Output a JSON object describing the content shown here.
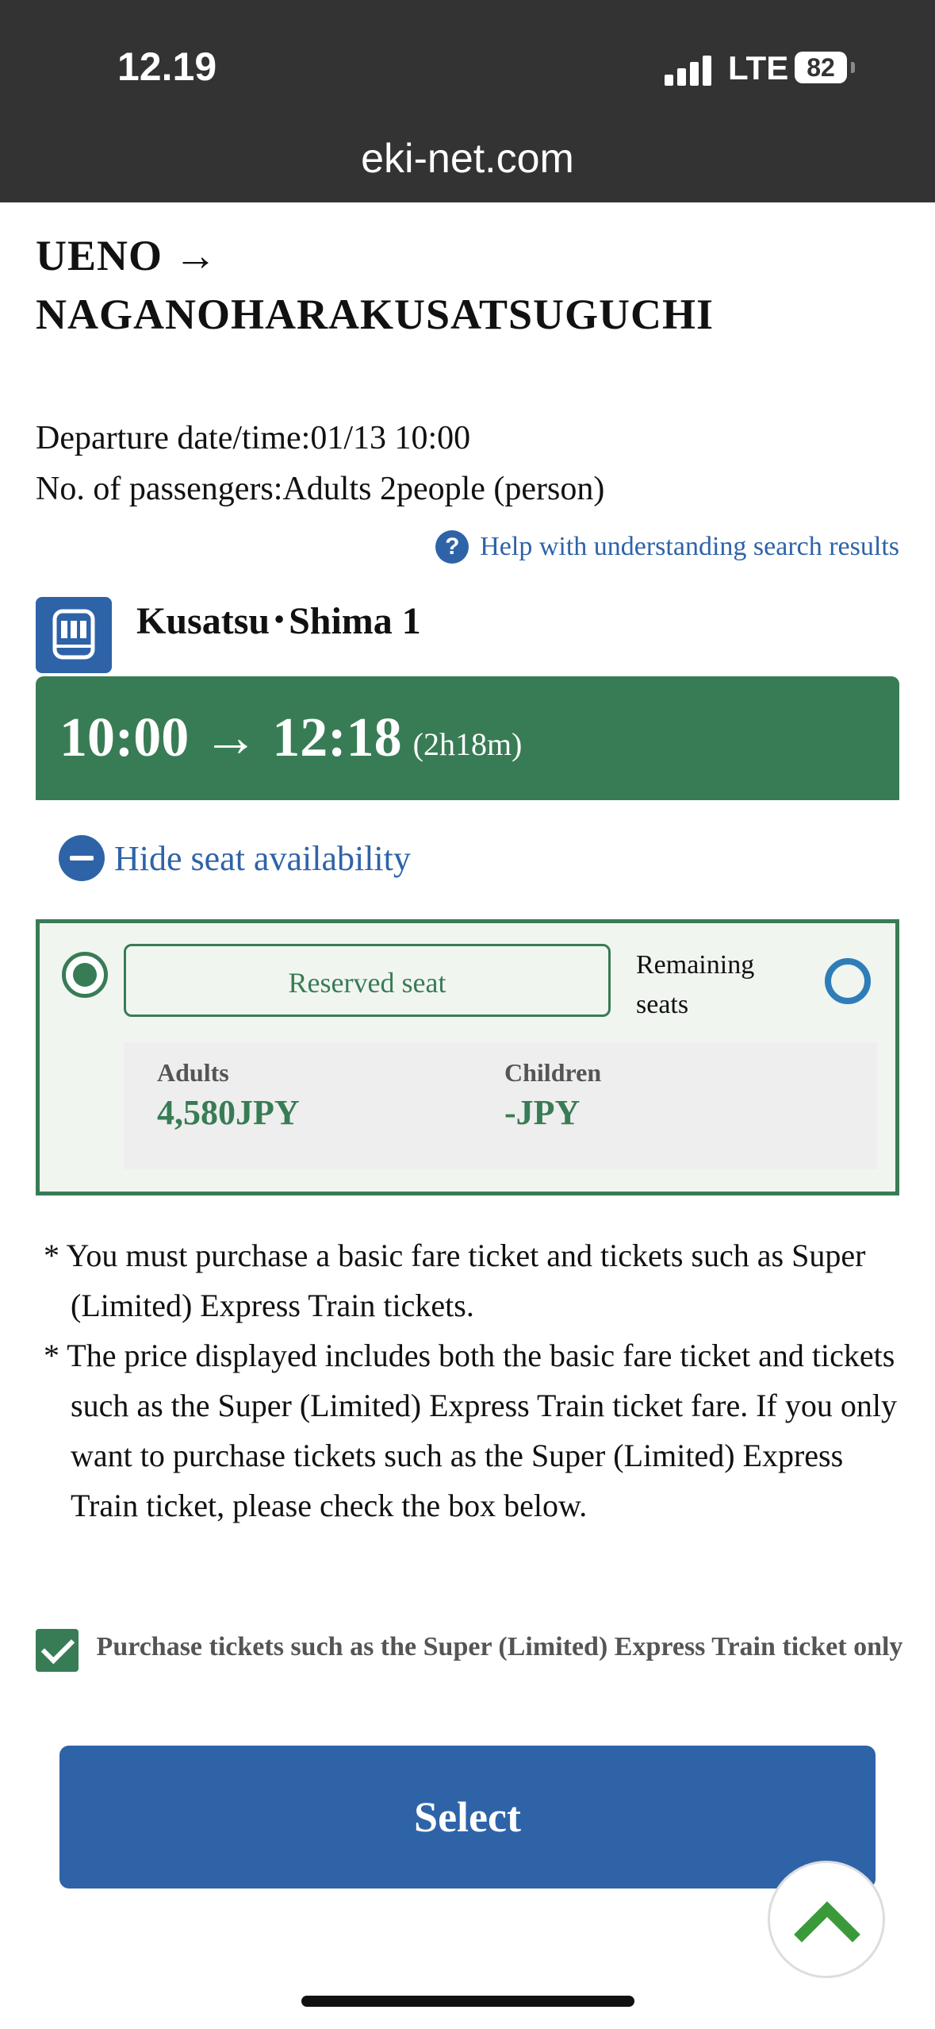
{
  "status_bar": {
    "time": "12.19",
    "network": "LTE",
    "battery": "82"
  },
  "browser": {
    "url": "eki-net.com"
  },
  "route": {
    "from": "UENO →",
    "to": "NAGANOHARAKUSATSUGUCHI"
  },
  "search_info": {
    "departure": "Departure date/time:01/13 10:00",
    "passengers": "No. of passengers:Adults 2people (person)"
  },
  "help_link": "Help with understanding search results",
  "train": {
    "icon": "train-icon",
    "name": "Kusatsu･Shima 1",
    "times": "10:00 → 12:18",
    "duration": "(2h18m)"
  },
  "seat_toggle_label": "Hide seat availability",
  "seat_option": {
    "type": "Reserved seat",
    "remaining_label": "Remaining seats",
    "availability_icon": "circle",
    "adults_label": "Adults",
    "adults_fare": "4,580JPY",
    "children_label": "Children",
    "children_fare": "-JPY"
  },
  "notes": [
    "* You must purchase a basic fare ticket and tickets such as Super (Limited) Express Train tickets.",
    "* The price displayed includes both the basic fare ticket and tickets such as the Super (Limited) Express Train ticket fare. If you only want to purchase tickets such as the Super (Limited) Express Train ticket, please check the box below."
  ],
  "express_only": {
    "label": "Purchase tickets such as the Super (Limited) Express Train ticket only",
    "checked": true
  },
  "select_button": "Select",
  "colors": {
    "green": "#387c55",
    "blue": "#2e63a8",
    "status_bg": "#333333"
  }
}
